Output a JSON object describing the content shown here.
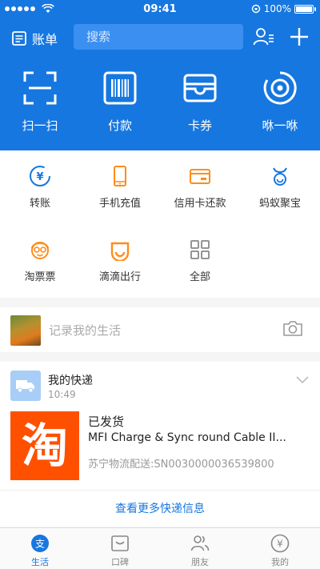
{
  "status_bar": {
    "time": "09:41",
    "battery": "100%",
    "battery_level": 1.0
  },
  "header": {
    "bill_label": "账单",
    "search_placeholder": "搜索",
    "icons": {
      "bill": "bill-icon",
      "search": "search-icon",
      "mic": "microphone-icon",
      "contacts": "contacts-icon",
      "add": "plus-icon"
    },
    "quick_actions": [
      {
        "label": "扫一扫",
        "icon": "scan-icon"
      },
      {
        "label": "付款",
        "icon": "barcode-icon"
      },
      {
        "label": "卡券",
        "icon": "wallet-icon"
      },
      {
        "label": "咻一咻",
        "icon": "shake-icon"
      }
    ]
  },
  "grid": {
    "items": [
      {
        "label": "转账",
        "icon": "transfer-icon"
      },
      {
        "label": "手机充值",
        "icon": "phone-icon"
      },
      {
        "label": "信用卡还款",
        "icon": "credit-card-icon"
      },
      {
        "label": "蚂蚁聚宝",
        "icon": "ant-icon"
      },
      {
        "label": "淘票票",
        "icon": "ticket-mascot-icon"
      },
      {
        "label": "滴滴出行",
        "icon": "didi-icon"
      },
      {
        "label": "全部",
        "icon": "grid-icon"
      }
    ]
  },
  "life": {
    "placeholder": "记录我的生活"
  },
  "express": {
    "title": "我的快递",
    "time": "10:49",
    "logo_text": "淘",
    "status": "已发货",
    "product": "MFI Charge & Sync round Cable II...",
    "tracking": "苏宁物流配送:SN0030000036539800",
    "more": "查看更多快递信息"
  },
  "tabbar": {
    "tabs": [
      {
        "label": "生活",
        "icon": "life-icon",
        "active": true
      },
      {
        "label": "口碑",
        "icon": "koubei-icon",
        "active": false
      },
      {
        "label": "朋友",
        "icon": "friends-icon",
        "active": false
      },
      {
        "label": "我的",
        "icon": "profile-icon",
        "active": false
      }
    ]
  },
  "colors": {
    "brand_blue": "#1677e0",
    "accent_orange": "#ff8c1a",
    "taobao_orange": "#ff5000"
  }
}
